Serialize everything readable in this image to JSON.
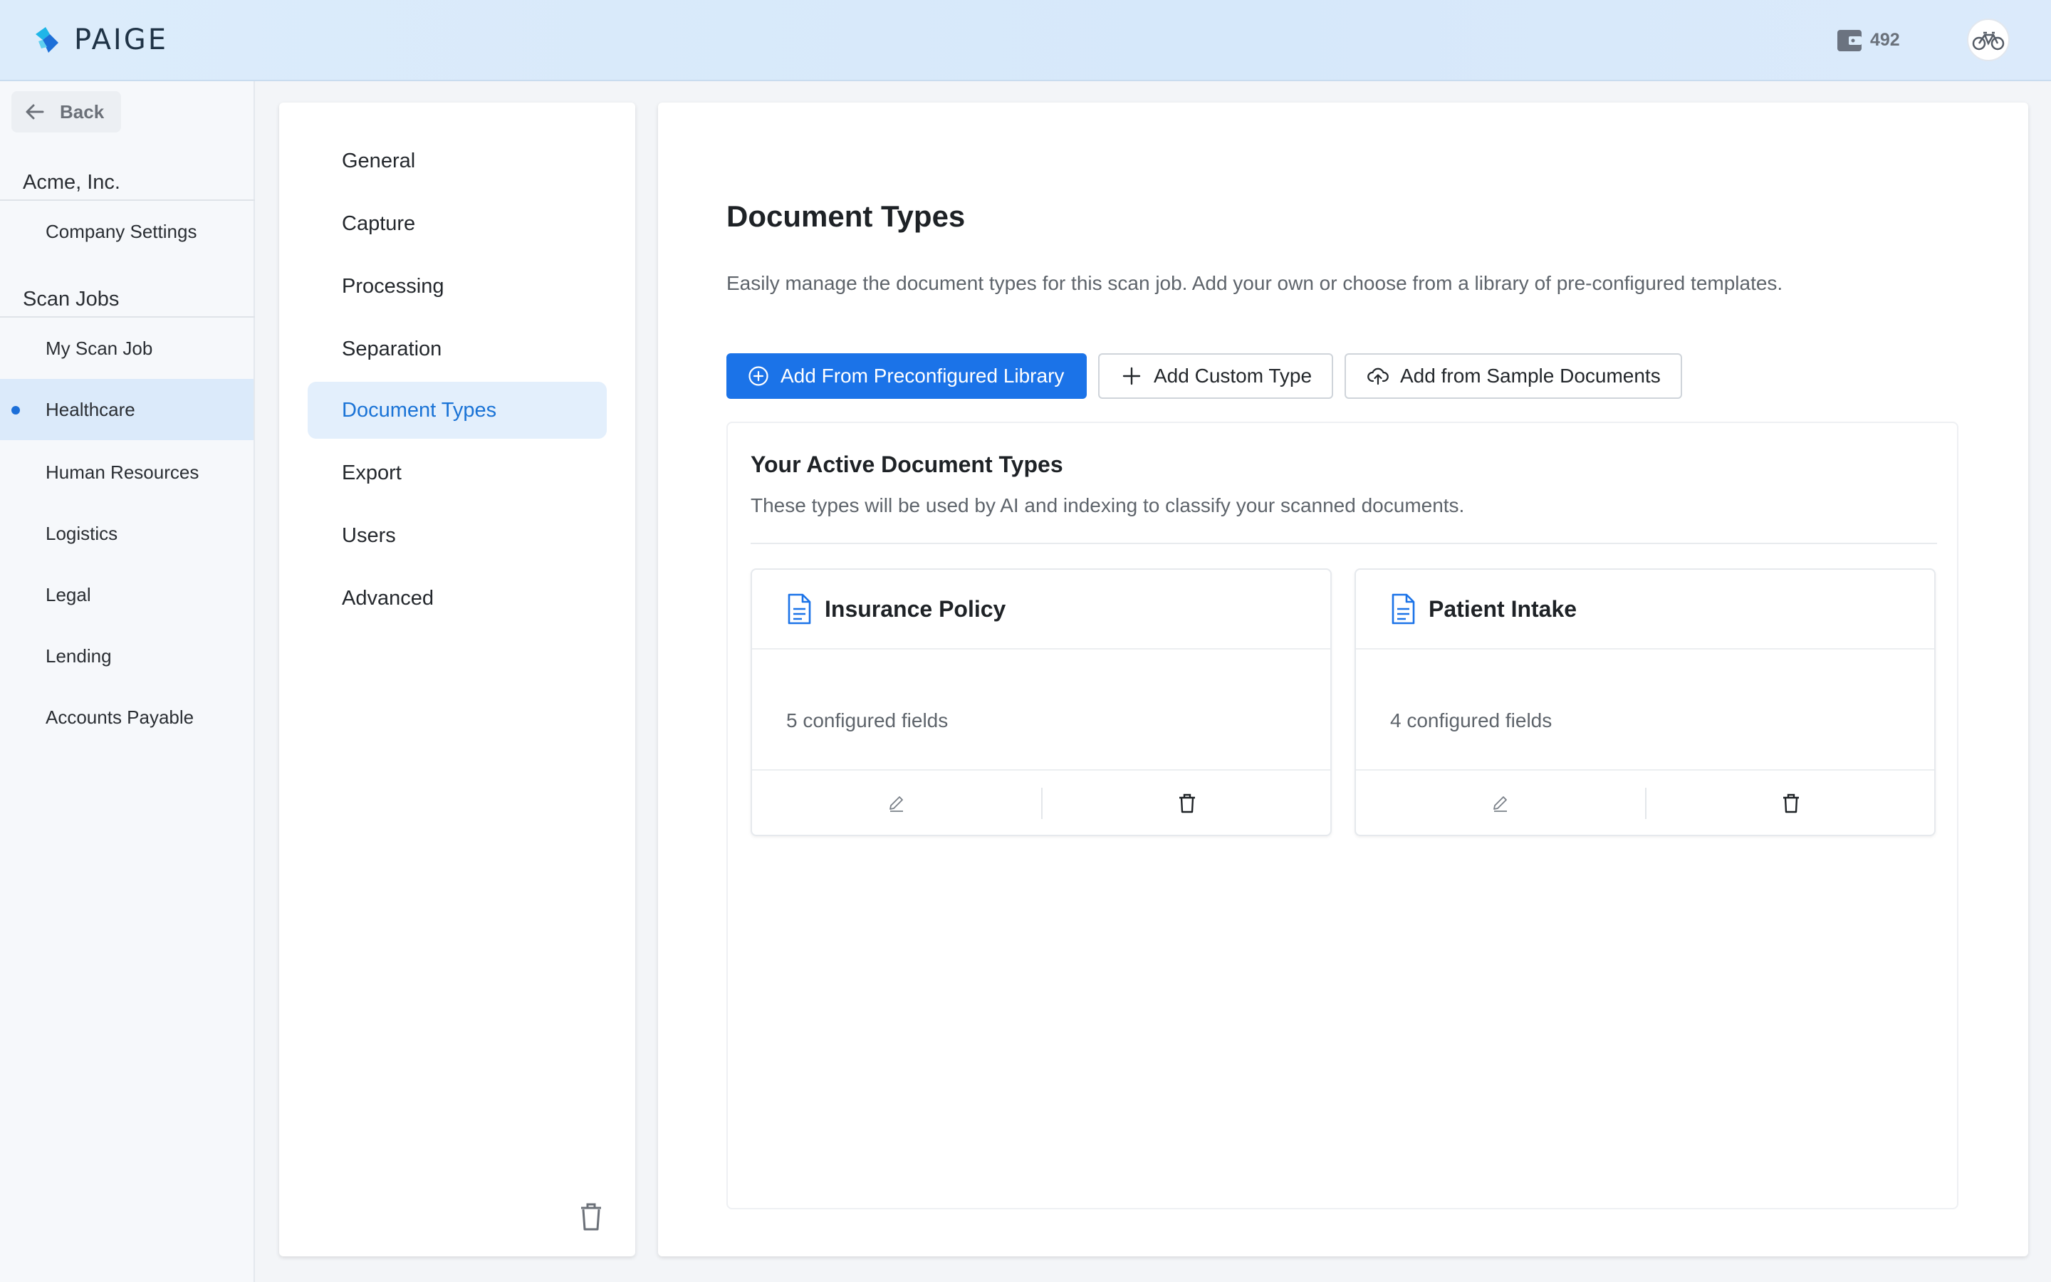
{
  "header": {
    "brand": "PAIGE",
    "credits": "492",
    "colors": {
      "brand_cyan": "#1fb6e8",
      "brand_blue": "#1c6fd8",
      "accent": "#1b73e8"
    }
  },
  "sidebar": {
    "back_label": "Back",
    "company": {
      "name": "Acme, Inc.",
      "items": [
        {
          "label": "Company Settings"
        }
      ]
    },
    "scan_jobs": {
      "title": "Scan Jobs",
      "items": [
        {
          "label": "My Scan Job"
        },
        {
          "label": "Healthcare",
          "active": true
        },
        {
          "label": "Human Resources"
        },
        {
          "label": "Logistics"
        },
        {
          "label": "Legal"
        },
        {
          "label": "Lending"
        },
        {
          "label": "Accounts Payable"
        }
      ]
    }
  },
  "settings_nav": {
    "items": [
      {
        "label": "General"
      },
      {
        "label": "Capture"
      },
      {
        "label": "Processing"
      },
      {
        "label": "Separation"
      },
      {
        "label": "Document Types",
        "active": true
      },
      {
        "label": "Export"
      },
      {
        "label": "Users"
      },
      {
        "label": "Advanced"
      }
    ]
  },
  "main": {
    "title": "Document Types",
    "description": "Easily manage the document types for this scan job. Add your own or choose from a library of pre-configured templates.",
    "buttons": {
      "library": "Add From Preconfigured Library",
      "custom": "Add Custom Type",
      "sample": "Add from Sample Documents"
    },
    "active_types": {
      "title": "Your Active Document Types",
      "description": "These types will be used by AI and indexing to classify your scanned documents.",
      "cards": [
        {
          "name": "Insurance Policy",
          "fields": "5 configured fields"
        },
        {
          "name": "Patient Intake",
          "fields": "4 configured fields"
        }
      ]
    }
  },
  "icons": [
    "arrow-left-icon",
    "wallet-icon",
    "bicycle-icon",
    "plus-circle-icon",
    "plus-icon",
    "cloud-upload-icon",
    "document-icon",
    "pencil-icon",
    "trash-icon"
  ]
}
